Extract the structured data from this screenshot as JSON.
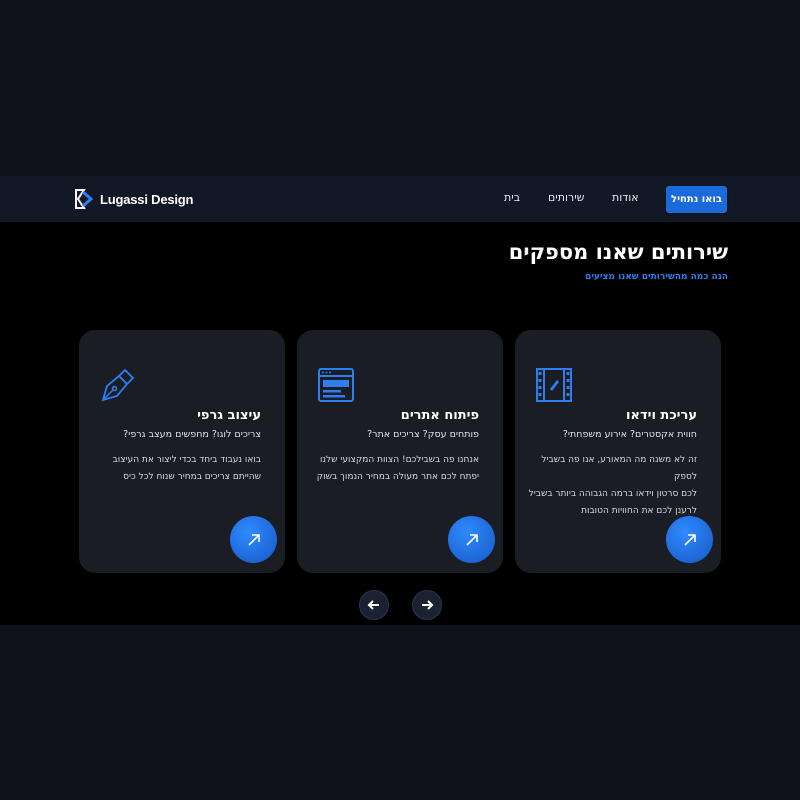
{
  "header": {
    "logo_text": "Lugassi Design",
    "nav": [
      "בית",
      "שירותים",
      "אודות"
    ],
    "cta_label": "בואו נתחיל"
  },
  "services": {
    "title": "שירותים שאנו מספקים",
    "subtitle": "הנה כמה מהשירותים שאנו מציעים",
    "cards": [
      {
        "icon": "film-edit-icon",
        "title": "עריכת וידאו",
        "subtitle": "חווית אקסטרים? אירוע משפחתי?",
        "desc_lines": [
          "זה לא משנה מה המאורע, אנו פה בשביל לספק",
          "לכם סרטון וידאו ברמה הגבוהה ביותר בשביל",
          "לרענן לכם את החוויות הטובות"
        ]
      },
      {
        "icon": "browser-window-icon",
        "title": "פיתוח אתרים",
        "subtitle": "פותחים עסק? צריכים אתר?",
        "desc_lines": [
          "אנחנו פה בשבילכם! הצוות המקצועי שלנו",
          "יפתח לכם אתר מעולה במחיר הנמוך בשוק"
        ]
      },
      {
        "icon": "pen-nib-icon",
        "title": "עיצוב גרפי",
        "subtitle": "צריכים לוגו? מחפשים מעצב גרפי?",
        "desc_lines": [
          "בואו נעבוד ביחד בכדי ליצור את העיצוב",
          "שהייתם צריכים במחיר שנוח לכל כיס"
        ]
      }
    ]
  },
  "colors": {
    "accent": "#1b6ad9",
    "card_bg": "#1b1d24",
    "subtitle": "#2d7ff0"
  }
}
